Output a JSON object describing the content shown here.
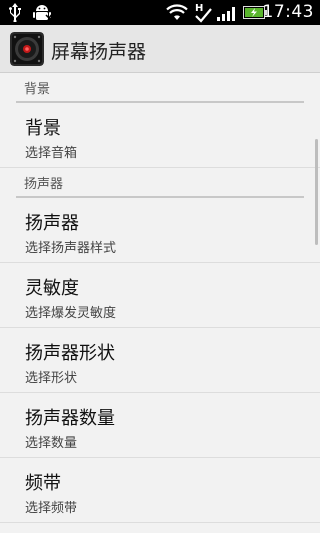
{
  "status_bar": {
    "time": "17:43",
    "icons": [
      "usb-icon",
      "android-debug-icon",
      "wifi-icon",
      "h-network-icon",
      "signal-icon",
      "battery-charging-icon"
    ],
    "battery_color": "#5ab52d"
  },
  "app_bar": {
    "title": "屏幕扬声器",
    "icon": "speaker-app-icon"
  },
  "categories": {
    "background": "背景",
    "speaker": "扬声器"
  },
  "prefs": [
    {
      "title": "背景",
      "summary": "选择音箱"
    },
    {
      "title": "扬声器",
      "summary": "选择扬声器样式"
    },
    {
      "title": "灵敏度",
      "summary": "选择爆发灵敏度"
    },
    {
      "title": "扬声器形状",
      "summary": "选择形状"
    },
    {
      "title": "扬声器数量",
      "summary": "选择数量"
    },
    {
      "title": "频带",
      "summary": "选择频带"
    }
  ]
}
